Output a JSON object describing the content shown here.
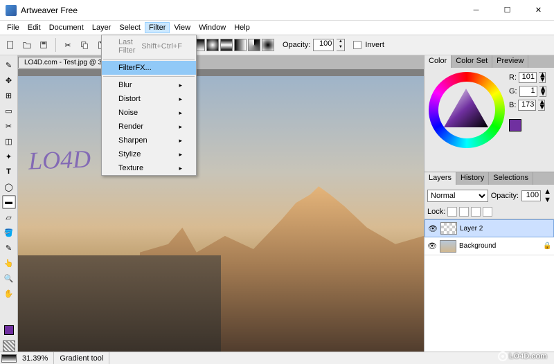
{
  "window": {
    "title": "Artweaver Free"
  },
  "menu": {
    "items": [
      "File",
      "Edit",
      "Document",
      "Layer",
      "Select",
      "Filter",
      "View",
      "Window",
      "Help"
    ],
    "active": "Filter"
  },
  "filter_menu": {
    "last_filter": "Last Filter",
    "last_filter_shortcut": "Shift+Ctrl+F",
    "filterfx": "FilterFX...",
    "blur": "Blur",
    "distort": "Distort",
    "noise": "Noise",
    "render": "Render",
    "sharpen": "Sharpen",
    "stylize": "Stylize",
    "texture": "Texture"
  },
  "toolbar": {
    "opacity_label": "Opacity:",
    "opacity_value": "100",
    "invert_label": "Invert"
  },
  "document": {
    "tab_title": "LO4D.com - Test.jpg @ 31..."
  },
  "handwriting": "LO4D",
  "color_panel": {
    "tabs": [
      "Color",
      "Color Set",
      "Preview"
    ],
    "r_label": "R:",
    "r_value": "101",
    "g_label": "G:",
    "g_value": "1",
    "b_label": "B:",
    "b_value": "173"
  },
  "layers_panel": {
    "tabs": [
      "Layers",
      "History",
      "Selections"
    ],
    "blend_mode": "Normal",
    "opacity_label": "Opacity:",
    "opacity_value": "100",
    "lock_label": "Lock:",
    "layers": [
      {
        "name": "Layer 2",
        "visible": true,
        "active": true,
        "locked": false
      },
      {
        "name": "Background",
        "visible": true,
        "active": false,
        "locked": true
      }
    ]
  },
  "status": {
    "zoom": "31.39%",
    "tool": "Gradient tool"
  },
  "watermark": "LO4D.com",
  "icons": {
    "new": "new-file",
    "open": "open",
    "save": "save",
    "cut": "cut",
    "copy": "copy",
    "paste": "paste",
    "undo": "undo",
    "redo": "redo"
  }
}
